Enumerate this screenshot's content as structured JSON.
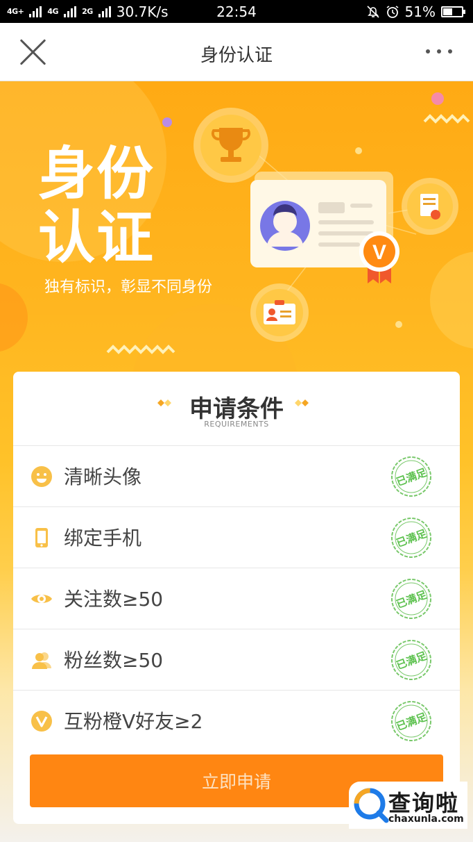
{
  "status_bar": {
    "network_1": "4G+",
    "network_2": "4G",
    "network_3": "2G",
    "speed": "30.7K/s",
    "time": "22:54",
    "battery": "51%",
    "battery_level": 0.51
  },
  "nav": {
    "title": "身份认证",
    "close_icon": "close-icon",
    "more_icon": "more-icon"
  },
  "hero": {
    "title_line1": "身份",
    "title_line2": "认证",
    "subtitle": "独有标识，彰显不同身份",
    "badge_letter": "V"
  },
  "requirements": {
    "title": "申请条件",
    "subtitle": "REQUIREMENTS",
    "stamp_text": "已满足",
    "items": [
      {
        "label": "清晰头像",
        "icon": "smiley-icon",
        "status": "已满足"
      },
      {
        "label": "绑定手机",
        "icon": "phone-icon",
        "status": "已满足"
      },
      {
        "label": "关注数≥50",
        "icon": "eye-icon",
        "status": "已满足"
      },
      {
        "label": "粉丝数≥50",
        "icon": "users-icon",
        "status": "已满足"
      },
      {
        "label": "互粉橙V好友≥2",
        "icon": "v-badge-icon",
        "status": "已满足"
      }
    ]
  },
  "apply_button": "立即申请",
  "watermark": {
    "text": "查询啦",
    "url": "chaxunla.com"
  },
  "colors": {
    "accent": "#ff8612",
    "hero_top": "#ffaa14",
    "icon": "#f8c048",
    "stamp": "#5cc14e"
  }
}
